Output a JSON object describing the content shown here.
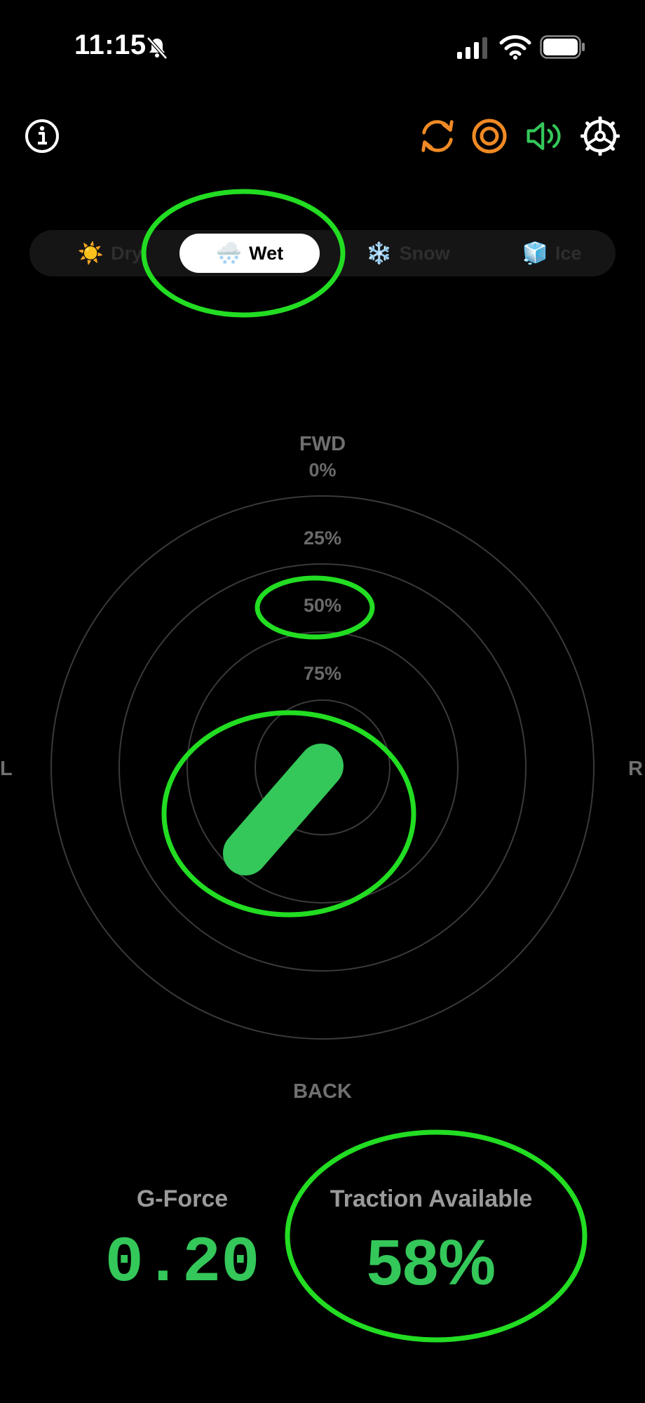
{
  "status_bar": {
    "time": "11:15"
  },
  "toolbar": {
    "icons": [
      "info-icon",
      "refresh-icon",
      "target-icon",
      "speaker-icon",
      "settings-gear-icon"
    ]
  },
  "conditions": {
    "options": [
      {
        "label": "Dry",
        "emoji": "☀️"
      },
      {
        "label": "Wet",
        "emoji": "🌨️"
      },
      {
        "label": "Snow",
        "emoji": "❄️"
      },
      {
        "label": "Ice",
        "emoji": "🧊"
      }
    ],
    "selected": "Wet"
  },
  "radar": {
    "fwd_label": "FWD",
    "back_label": "BACK",
    "left_label": "L",
    "right_label": "R",
    "rings": [
      "0%",
      "25%",
      "50%",
      "75%"
    ]
  },
  "readouts": {
    "gforce_label": "G-Force",
    "gforce_value": "0.20",
    "traction_label": "Traction Available",
    "traction_value": "58%"
  },
  "colors": {
    "accent_green": "#34c759",
    "highlight_green": "#22dd22",
    "orange": "#f08a24"
  }
}
